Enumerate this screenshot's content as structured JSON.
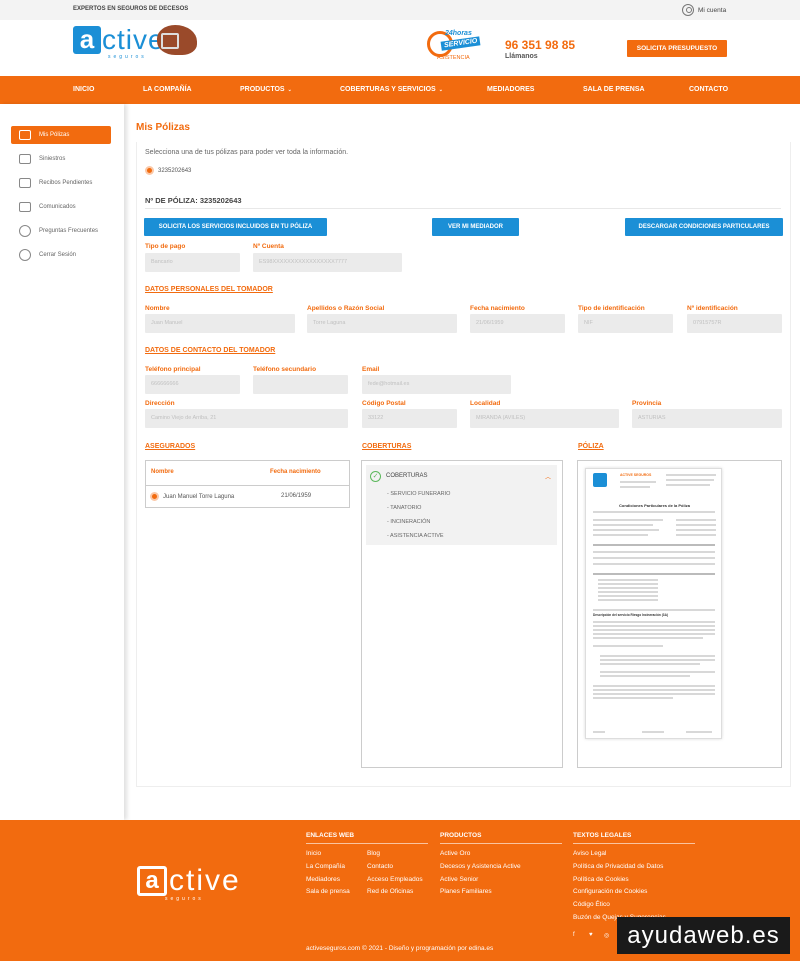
{
  "topbar": {
    "tagline": "EXPERTOS EN SEGUROS DE DECESOS",
    "account": "Mi cuenta"
  },
  "brand": {
    "logo_letter": "a",
    "logo_text": "ctive",
    "logo_sub": "seguros",
    "orange": "#f26b0f",
    "blue": "#1b8fd6"
  },
  "service_badge": {
    "hours": "24horas",
    "label": "SERVICIO",
    "sub": "ASISTENCIA"
  },
  "contact": {
    "phone": "96 351 98 85",
    "call": "Llámanos",
    "quote_button": "SOLICITA PRESUPUESTO"
  },
  "nav": {
    "items": [
      "INICIO",
      "LA COMPAÑÍA",
      "PRODUCTOS",
      "COBERTURAS Y SERVICIOS",
      "MEDIADORES",
      "SALA DE PRENSA",
      "CONTACTO"
    ],
    "dropdown_caret": "⌄"
  },
  "sidebar": {
    "items": [
      "Mis Pólizas",
      "Siniestros",
      "Recibos Pendientes",
      "Comunicados",
      "Preguntas Frecuentes",
      "Cerrar Sesión"
    ]
  },
  "page": {
    "title": "Mis Pólizas",
    "intro": "Selecciona una de tus pólizas para poder ver toda la información.",
    "policy_option": "3235202643",
    "policy_number_label": "Nº DE PÓLIZA: 3235202643"
  },
  "buttons": {
    "services": "SOLICITA LOS SERVICIOS INCLUIDOS EN TU PÓLIZA",
    "mediator": "VER MI MEDIADOR",
    "conditions": "DESCARGAR CONDICIONES PARTICULARES"
  },
  "payment": {
    "type_label": "Tipo de pago",
    "type_value": "Bancario",
    "account_label": "Nº Cuenta",
    "account_value": "ES98XXXXXXXXXXXXXXXXX7777"
  },
  "holder": {
    "section": "DATOS PERSONALES DEL TOMADOR",
    "name_label": "Nombre",
    "name_value": "Juan Manuel",
    "surname_label": "Apellidos o Razón Social",
    "surname_value": "Torre Laguna",
    "birth_label": "Fecha nacimiento",
    "birth_value": "21/06/1959",
    "id_type_label": "Tipo de identificación",
    "id_type_value": "NIF",
    "id_label": "Nº identificación",
    "id_value": "07915757R"
  },
  "contact_data": {
    "section": "DATOS DE CONTACTO DEL TOMADOR",
    "phone_label": "Teléfono principal",
    "phone_value": "666666666",
    "phone2_label": "Teléfono secundario",
    "phone2_value": "",
    "email_label": "Email",
    "email_value": "fede@hotmail.es",
    "address_label": "Dirección",
    "address_value": "Camino Viejo de Arriba, 21",
    "zip_label": "Código Postal",
    "zip_value": "33122",
    "city_label": "Localidad",
    "city_value": "MIRANDA (AVILES)",
    "province_label": "Provincia",
    "province_value": "ASTURIAS"
  },
  "insured": {
    "section": "ASEGURADOS",
    "col_name": "Nombre",
    "col_birth": "Fecha nacimiento",
    "rows": [
      {
        "name": "Juan Manuel Torre Laguna",
        "birth": "21/06/1959"
      }
    ]
  },
  "coverages": {
    "section": "COBERTURAS",
    "header": "COBERTURAS",
    "items": [
      "- SERVICIO FUNERARIO",
      "- TANATORIO",
      "- INCINERACIÓN",
      "- ASISTENCIA ACTIVE"
    ]
  },
  "policy_doc": {
    "section": "PÓLIZA",
    "doc_title": "Condiciones Particulares de la Póliza",
    "doc_brand": "ACTIVE SEGUROS",
    "doc_subtitle": "Descripción del servicio Riesgo Incineración (3A)"
  },
  "footer": {
    "web_title": "ENLACES WEB",
    "web_col1": [
      "Inicio",
      "La Compañía",
      "Mediadores",
      "Sala de prensa"
    ],
    "web_col2": [
      "Blog",
      "Contacto",
      "Acceso Empleados",
      "Red de Oficinas"
    ],
    "products_title": "PRODUCTOS",
    "products": [
      "Active Oro",
      "Decesos y Asistencia Active",
      "Active Senior",
      "Planes Familiares"
    ],
    "legal_title": "TEXTOS LEGALES",
    "legal": [
      "Aviso Legal",
      "Política de Privacidad de Datos",
      "Política de Cookies",
      "Configuración de Cookies",
      "Código Ético",
      "Buzón de Quejas y Sugerencias"
    ],
    "social": [
      "f",
      "♥",
      "◎",
      "in"
    ],
    "copyright": "activeseguros.com © 2021 - Diseño y programación por edina.es",
    "watermark": "ayudaweb.es"
  }
}
